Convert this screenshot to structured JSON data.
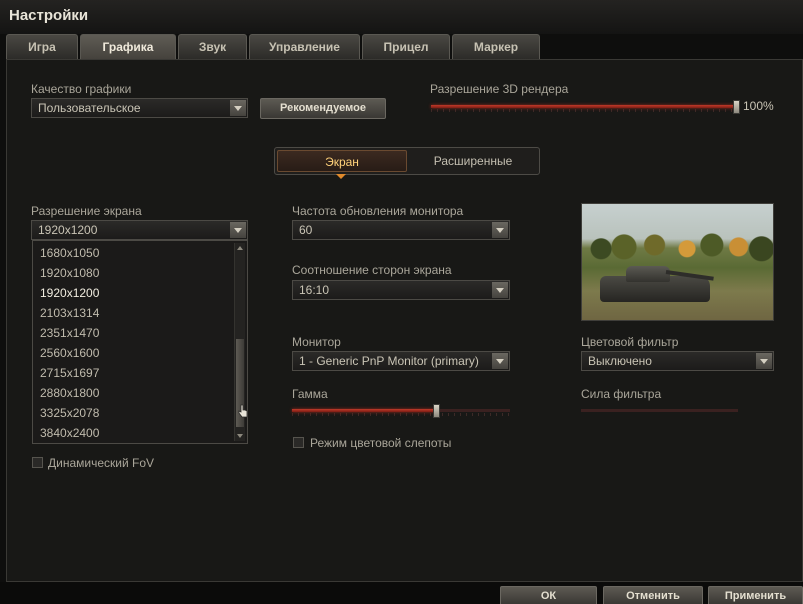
{
  "window": {
    "title": "Настройки"
  },
  "tabs": [
    {
      "label": "Игра"
    },
    {
      "label": "Графика",
      "active": true
    },
    {
      "label": "Звук"
    },
    {
      "label": "Управление"
    },
    {
      "label": "Прицел"
    },
    {
      "label": "Маркер"
    }
  ],
  "graphics_quality": {
    "label": "Качество графики",
    "value": "Пользовательское",
    "recommended_button": "Рекомендуемое"
  },
  "render_resolution": {
    "label": "Разрешение 3D рендера",
    "value_text": "100%",
    "percent": 100
  },
  "subtabs": [
    {
      "label": "Экран",
      "active": true
    },
    {
      "label": "Расширенные"
    }
  ],
  "screen_resolution": {
    "label": "Разрешение экрана",
    "value": "1920x1200",
    "options": [
      "1680x1050",
      "1920x1080",
      "1920x1200",
      "2103x1314",
      "2351x1470",
      "2560x1600",
      "2715x1697",
      "2880x1800",
      "3325x2078",
      "3840x2400"
    ],
    "selected": "1920x1200"
  },
  "dynamic_fov": {
    "label": "Динамический FoV",
    "checked": false
  },
  "refresh_rate": {
    "label": "Частота обновления монитора",
    "value": "60"
  },
  "aspect_ratio": {
    "label": "Соотношение сторон экрана",
    "value": "16:10"
  },
  "monitor": {
    "label": "Монитор",
    "value": "1 - Generic PnP Monitor (primary)"
  },
  "gamma": {
    "label": "Гамма",
    "level": 0.67
  },
  "color_blind": {
    "label": "Режим цветовой слепоты",
    "checked": false
  },
  "color_filter": {
    "label": "Цветовой фильтр",
    "value": "Выключено"
  },
  "filter_strength": {
    "label": "Сила фильтра",
    "level": 0
  },
  "footer": {
    "ok": "ОК",
    "cancel": "Отменить",
    "apply": "Применить"
  },
  "colors": {
    "accent_red": "#c03a2a",
    "accent_orange": "#e08a2c",
    "background": "#181816"
  }
}
